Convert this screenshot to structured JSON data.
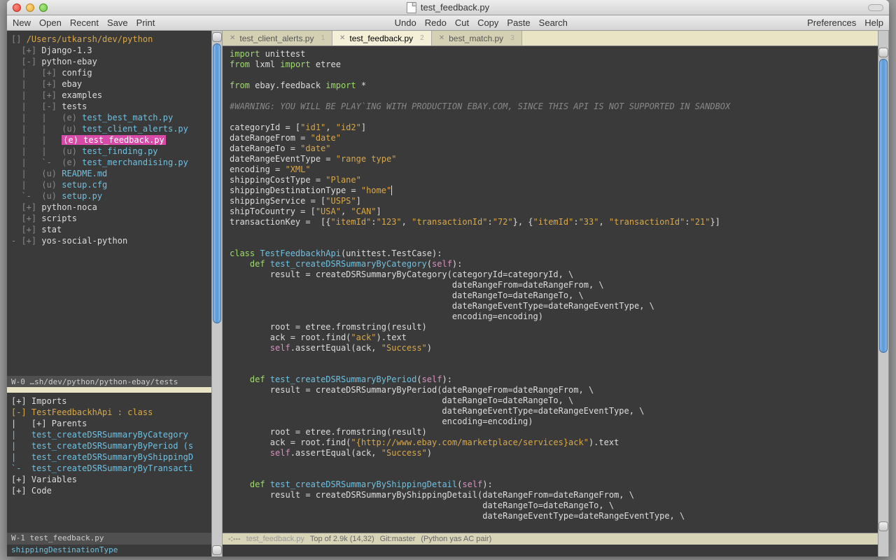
{
  "window": {
    "title": "test_feedback.py"
  },
  "menubar": {
    "left": [
      "New",
      "Open",
      "Recent",
      "Save",
      "Print"
    ],
    "mid": [
      "Undo",
      "Redo",
      "Cut",
      "Copy",
      "Paste",
      "Search"
    ],
    "right": [
      "Preferences",
      "Help"
    ]
  },
  "tree": {
    "root": "/Users/utkarsh/dev/python",
    "lines": [
      {
        "prefix": "  [+] ",
        "text": "Django-1.3",
        "cls": "tr-white"
      },
      {
        "prefix": "  [-] ",
        "text": "python-ebay",
        "cls": "tr-white"
      },
      {
        "prefix": "  |   [+] ",
        "text": "config",
        "cls": "tr-white"
      },
      {
        "prefix": "  |   [+] ",
        "text": "ebay",
        "cls": "tr-white"
      },
      {
        "prefix": "  |   [+] ",
        "text": "examples",
        "cls": "tr-white"
      },
      {
        "prefix": "  |   [-] ",
        "text": "tests",
        "cls": "tr-white"
      },
      {
        "prefix": "  |   |   (e) ",
        "text": "test_best_match.py",
        "cls": "tr-blue"
      },
      {
        "prefix": "  |   |   (u) ",
        "text": "test_client_alerts.py",
        "cls": "tr-blue"
      },
      {
        "prefix": "  |   |   ",
        "text": "(e) test_feedback.py",
        "cls": "tr-active"
      },
      {
        "prefix": "  |   |   (u) ",
        "text": "test_finding.py",
        "cls": "tr-blue"
      },
      {
        "prefix": "  |   `-  (e) ",
        "text": "test_merchandising.py",
        "cls": "tr-blue"
      },
      {
        "prefix": "  |   (u) ",
        "text": "README.md",
        "cls": "tr-blue"
      },
      {
        "prefix": "  |   (u) ",
        "text": "setup.cfg",
        "cls": "tr-blue"
      },
      {
        "prefix": "  `-  (u) ",
        "text": "setup.py",
        "cls": "tr-blue"
      },
      {
        "prefix": "  [+] ",
        "text": "python-noca",
        "cls": "tr-white"
      },
      {
        "prefix": "  [+] ",
        "text": "scripts",
        "cls": "tr-white"
      },
      {
        "prefix": "  [+] ",
        "text": "stat",
        "cls": "tr-white"
      },
      {
        "prefix": "- [+] ",
        "text": "yos-social-python",
        "cls": "tr-white"
      }
    ]
  },
  "status_w0": "W-0 …sh/dev/python/python-ebay/tests",
  "outline": {
    "lines": [
      {
        "text": "[+] Imports",
        "cls": "tr-white"
      },
      {
        "text": "[-] TestFeedbackhApi : class",
        "cls": "out-gold"
      },
      {
        "text": "|   [+] Parents",
        "cls": "tr-white"
      },
      {
        "text": "|   test_createDSRSummaryByCategory",
        "cls": "out-blue"
      },
      {
        "text": "|   test_createDSRSummaryByPeriod (s",
        "cls": "out-blue"
      },
      {
        "text": "|   test_createDSRSummaryByShippingD",
        "cls": "out-blue"
      },
      {
        "text": "`-  test_createDSRSummaryByTransacti",
        "cls": "out-blue"
      },
      {
        "text": "[+] Variables",
        "cls": "tr-white"
      },
      {
        "text": "[+] Code",
        "cls": "tr-white"
      }
    ]
  },
  "status_w1": "W-1 test_feedback.py",
  "minibuffer": "shippingDestinationType",
  "tabs": [
    {
      "label": "test_client_alerts.py",
      "num": "1",
      "active": false
    },
    {
      "label": "test_feedback.py",
      "num": "2",
      "active": true
    },
    {
      "label": "best_match.py",
      "num": "3",
      "active": false
    }
  ],
  "modeline": {
    "mode": "-:---",
    "file": "test_feedback.py",
    "pos": "Top of 2.9k (14,32)",
    "git": "Git:master",
    "modes": "(Python yas AC pair)"
  },
  "code": {
    "l1": {
      "kw1": "import",
      "t": " unittest"
    },
    "l2": {
      "kw1": "from",
      "t1": " lxml ",
      "kw2": "import",
      "t2": " etree"
    },
    "l3": {
      "kw1": "from",
      "mod": " ebay.feedback ",
      "kw2": "import",
      "t": " *"
    },
    "cmt": "#WARNING: YOU WILL BE PLAY`ING WITH PRODUCTION EBAY.COM, SINCE THIS API IS NOT SUPPORTED IN SANDBOX",
    "a1": "categoryId = [",
    "a1s": "\"id1\"",
    "a1c": ", ",
    "a1s2": "\"id2\"",
    "a1e": "]",
    "a2": "dateRangeFrom = ",
    "a2s": "\"date\"",
    "a3": "dateRangeTo = ",
    "a3s": "\"date\"",
    "a4": "dateRangeEventType = ",
    "a4s": "\"range type\"",
    "a5": "encoding = ",
    "a5s": "\"XML\"",
    "a6": "shippingCostType = ",
    "a6s": "\"Plane\"",
    "a7": "shippingDestinationType = ",
    "a7s": "\"home\"",
    "a8": "shippingService = [",
    "a8s": "\"USPS\"",
    "a8e": "]",
    "a9": "shipToCountry = [",
    "a9s": "\"USA\"",
    "a9c": ", ",
    "a9s2": "\"CAN\"",
    "a9e": "]",
    "a10": "transactionKey =  [{",
    "a10s1": "\"itemId\"",
    "a10c1": ":",
    "a10s2": "\"123\"",
    "a10c2": ", ",
    "a10s3": "\"transactionId\"",
    "a10c3": ":",
    "a10s4": "\"72\"",
    "a10c4": "}, {",
    "a10s5": "\"itemId\"",
    "a10c5": ":",
    "a10s6": "\"33\"",
    "a10c6": ", ",
    "a10s7": "\"transactionId\"",
    "a10c7": ":",
    "a10s8": "\"21\"",
    "a10e": "}]",
    "class_kw": "class",
    "class_name": " TestFeedbackhApi",
    "class_paren": "(unittest.TestCase):",
    "def_kw": "def",
    "m1_name": " test_createDSRSummaryByCategory",
    "m1_args": "(",
    "self": "self",
    "m1_close": "):",
    "m1_l1": "        result = createDSRSummaryByCategory(categoryId=categoryId, \\",
    "m1_l2": "                                            dateRangeFrom=dateRangeFrom, \\",
    "m1_l3": "                                            dateRangeTo=dateRangeTo, \\",
    "m1_l4": "                                            dateRangeEventType=dateRangeEventType, \\",
    "m1_l5": "                                            encoding=encoding)",
    "m1_l6": "        root = etree.fromstring(result)",
    "m1_l7a": "        ack = root.find(",
    "m1_l7s": "\"ack\"",
    "m1_l7b": ").text",
    "m1_l8a": "        ",
    "m1_l8b": ".assertEqual(ack, ",
    "m1_l8s": "\"Success\"",
    "m1_l8c": ")",
    "m2_name": " test_createDSRSummaryByPeriod",
    "m2_l1": "        result = createDSRSummaryByPeriod(dateRangeFrom=dateRangeFrom, \\",
    "m2_l2": "                                          dateRangeTo=dateRangeTo, \\",
    "m2_l3": "                                          dateRangeEventType=dateRangeEventType, \\",
    "m2_l4": "                                          encoding=encoding)",
    "m2_l5": "        root = etree.fromstring(result)",
    "m2_l6a": "        ack = root.find(",
    "m2_l6s": "\"{http://www.ebay.com/marketplace/services}ack\"",
    "m2_l6b": ").text",
    "m2_l7a": "        ",
    "m2_l7b": ".assertEqual(ack, ",
    "m2_l7s": "\"Success\"",
    "m2_l7c": ")",
    "m3_name": " test_createDSRSummaryByShippingDetail",
    "m3_l1": "        result = createDSRSummaryByShippingDetail(dateRangeFrom=dateRangeFrom, \\",
    "m3_l2": "                                                  dateRangeTo=dateRangeTo, \\",
    "m3_l3": "                                                  dateRangeEventType=dateRangeEventType, \\"
  }
}
